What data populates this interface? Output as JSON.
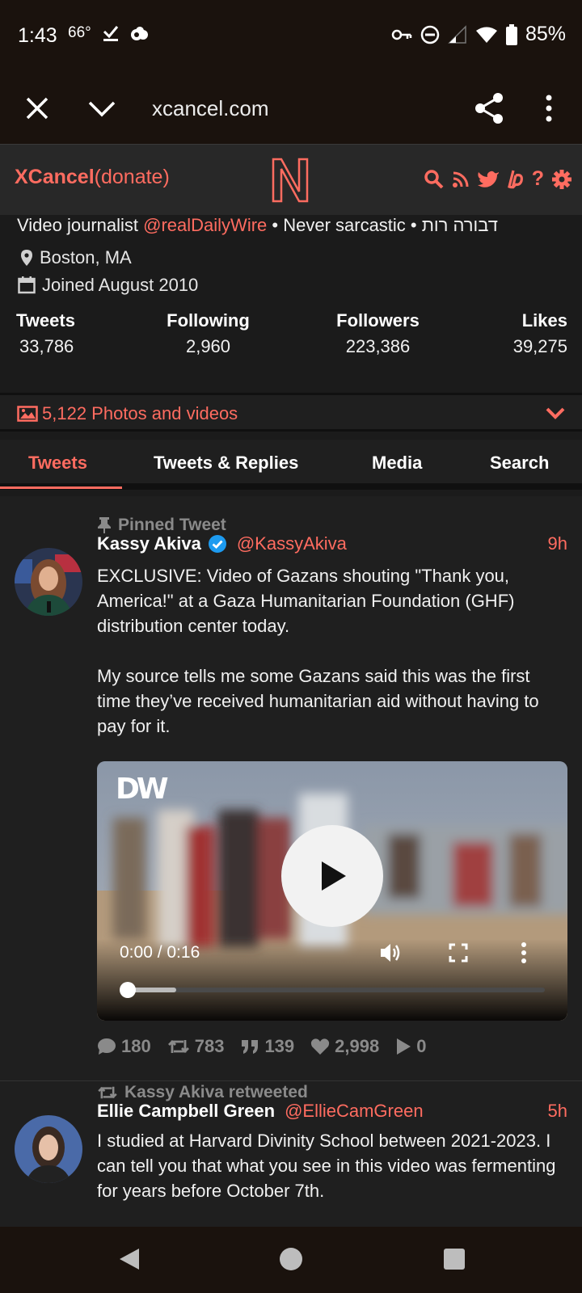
{
  "status_bar": {
    "time": "1:43",
    "temperature": "66°",
    "battery_percent": "85%",
    "left_icons": [
      "weather-icon",
      "download-done-icon",
      "cloud-icon"
    ],
    "right_icons": [
      "vpn-key-icon",
      "dnd-icon",
      "signal-icon",
      "wifi-icon",
      "battery-icon"
    ]
  },
  "browser": {
    "url": "xcancel.com"
  },
  "site_header": {
    "brand_bold": "XCancel",
    "brand_light": "(donate)",
    "accent_color": "#ff6c60",
    "icons": [
      "search-icon",
      "rss-icon",
      "twitter-icon",
      "liberapay-icon",
      "help-icon",
      "settings-icon"
    ]
  },
  "profile": {
    "bio_prefix": "Video journalist ",
    "bio_link": "@realDailyWire",
    "bio_suffix": " • Never sarcastic • דבורה רות",
    "location": "Boston, MA",
    "joined": "Joined August 2010",
    "stats": [
      {
        "label": "Tweets",
        "value": "33,786"
      },
      {
        "label": "Following",
        "value": "2,960"
      },
      {
        "label": "Followers",
        "value": "223,386"
      },
      {
        "label": "Likes",
        "value": "39,275"
      }
    ],
    "photos_videos": "5,122 Photos and videos"
  },
  "tabs": [
    {
      "label": "Tweets",
      "active": true
    },
    {
      "label": "Tweets & Replies",
      "active": false
    },
    {
      "label": "Media",
      "active": false
    },
    {
      "label": "Search",
      "active": false
    }
  ],
  "tweets": [
    {
      "context": "Pinned Tweet",
      "name": "Kassy Akiva",
      "verified": true,
      "handle": "@KassyAkiva",
      "time": "9h",
      "text_p1": "EXCLUSIVE: Video of Gazans shouting \"Thank you, America!\" at a Gaza Humanitarian Foundation (GHF) distribution center today.",
      "text_p2": "My source tells me some Gazans said this was the first time they’ve received humanitarian aid without having to pay for it.",
      "video": {
        "watermark": "DW",
        "time": "0:00 / 0:16",
        "progress_fraction": 0.0
      },
      "stats": {
        "replies": "180",
        "retweets": "783",
        "quotes": "139",
        "likes": "2,998",
        "plays": "0"
      }
    },
    {
      "context": "Kassy Akiva retweeted",
      "name": "Ellie Campbell Green",
      "handle": "@EllieCamGreen",
      "time": "5h",
      "text": "I studied at Harvard Divinity School between 2021-2023. I can tell you that what you see in this video was fermenting for years before October 7th."
    }
  ]
}
